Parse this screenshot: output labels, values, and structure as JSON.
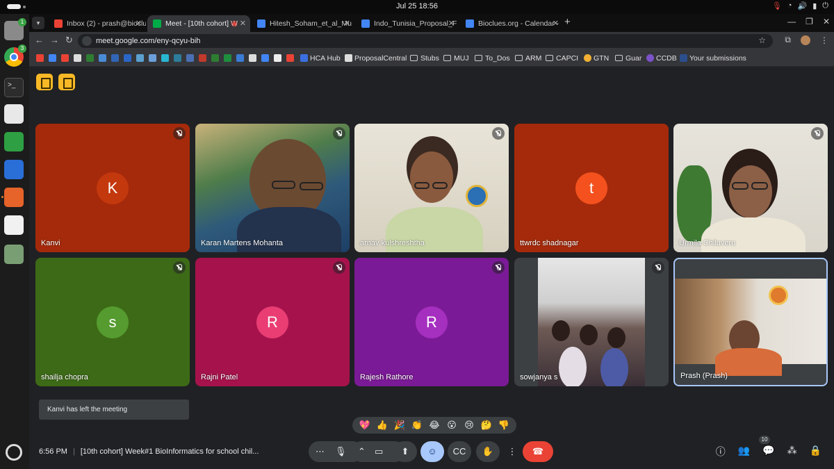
{
  "system": {
    "clock": "Jul 25  18:56",
    "dock_badges": [
      "1",
      "3"
    ]
  },
  "browser": {
    "tabs": [
      {
        "title": "Inbox (2) - prash@bioclue",
        "icon": "gmail-icon",
        "color": "#ea4335"
      },
      {
        "title": "Meet - [10th cohort] W",
        "icon": "meet-icon",
        "color": "#00ac47",
        "active": true
      },
      {
        "title": "Hitesh_Soham_et_al_Mu",
        "icon": "docs-icon",
        "color": "#4285f4"
      },
      {
        "title": "Indo_Tunisia_Proposal_F",
        "icon": "docs-icon",
        "color": "#4285f4"
      },
      {
        "title": "Bioclues.org - Calendar -",
        "icon": "calendar-icon",
        "color": "#4285f4"
      }
    ],
    "url": "meet.google.com/eny-qcyu-bih",
    "bookmarks": [
      {
        "label": "HCA Hub",
        "icon": "#3b6fe0"
      },
      {
        "label": "ProposalCentral",
        "icon": "#dddddd"
      },
      {
        "label": "Stubs",
        "folder": true
      },
      {
        "label": "MUJ",
        "folder": true
      },
      {
        "label": "To_Dos",
        "folder": true
      },
      {
        "label": "ARM",
        "folder": true
      },
      {
        "label": "CAPCI",
        "folder": true
      },
      {
        "label": "GTN",
        "icon": "#f2b134"
      },
      {
        "label": "Guar",
        "folder": true
      },
      {
        "label": "CCDB",
        "icon": "#7b52c8"
      },
      {
        "label": "Your submissions",
        "icon": "#2b4e8c"
      }
    ]
  },
  "meet": {
    "participants": [
      {
        "name": "Kanvi",
        "initial": "K",
        "bg": "#a52a0b",
        "avatar": "#c4380e",
        "muted": true
      },
      {
        "name": "Karan Martens Mohanta",
        "video": true,
        "muted": true
      },
      {
        "name": "arnav kulshreshtha",
        "video": true,
        "muted": true
      },
      {
        "name": "ttwrdc shadnagar",
        "initial": "t",
        "bg": "#a52a0b",
        "avatar": "#f4511e",
        "muted": false
      },
      {
        "name": "Urmila Chiluveru",
        "video": true,
        "muted": true
      },
      {
        "name": "shailja chopra",
        "initial": "s",
        "bg": "#3d6a17",
        "avatar": "#559b2f",
        "muted": true
      },
      {
        "name": "Rajni Patel",
        "initial": "R",
        "bg": "#a6134c",
        "avatar": "#e93d74",
        "muted": true
      },
      {
        "name": "Rajesh Rathore",
        "initial": "R",
        "bg": "#7b1a96",
        "avatar": "#a52fbf",
        "muted": true
      },
      {
        "name": "sowjanya s",
        "video": true,
        "muted": true
      },
      {
        "name": "Prash (Prash)",
        "video": true,
        "muted": false,
        "speaking": true
      }
    ],
    "toast": "Kanvi has left the meeting",
    "reactions": [
      "💖",
      "👍",
      "🎉",
      "👏",
      "😂",
      "😮",
      "😢",
      "🤔",
      "👎"
    ],
    "time": "6:56 PM",
    "meeting_title": "[10th cohort] Week#1 BioInformatics for school chil...",
    "participant_count": "10"
  }
}
